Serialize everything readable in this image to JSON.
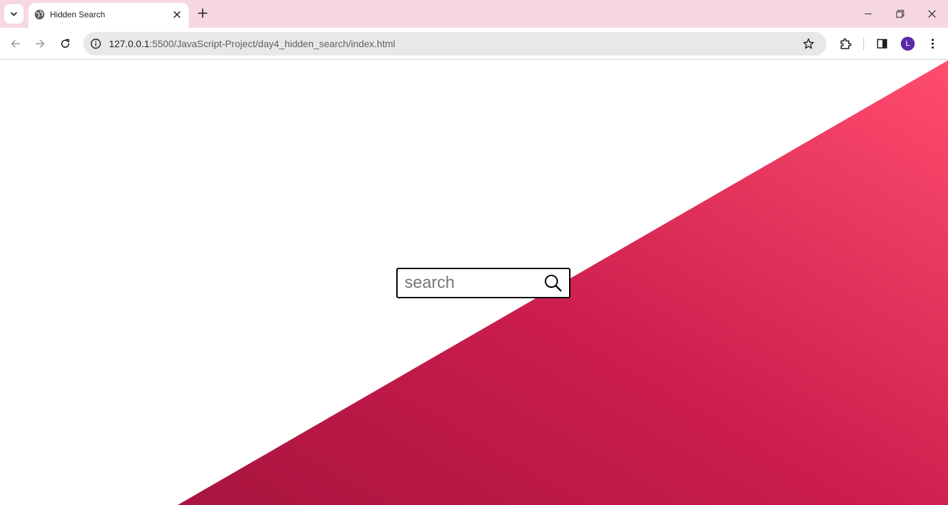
{
  "browser": {
    "tab": {
      "title": "Hidden Search",
      "favicon": "globe-icon"
    },
    "url": {
      "host": "127.0.0.1",
      "path": ":5500/JavaScript-Project/day4_hidden_search/index.html"
    },
    "profile_initial": "L",
    "colors": {
      "tabstrip": "#f7d7e4",
      "avatar": "#5b2aa8"
    }
  },
  "page": {
    "search": {
      "placeholder": "search",
      "icon": "search-icon"
    },
    "colors": {
      "gradient_start": "#a8143f",
      "gradient_mid": "#cb1d4e",
      "gradient_end": "#ff4d6d"
    }
  }
}
